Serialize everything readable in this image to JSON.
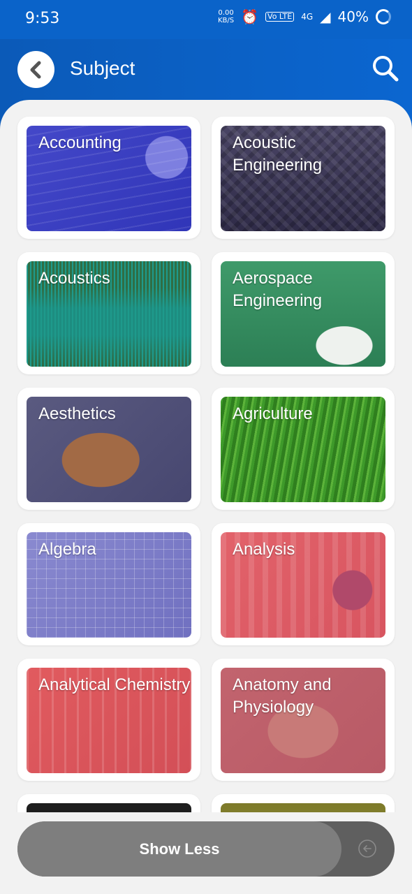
{
  "status_bar": {
    "time": "9:53",
    "net_speed_top": "0.00",
    "net_speed_bottom": "KB/S",
    "volte": "Vo LTE",
    "network": "4G",
    "battery": "40%"
  },
  "header": {
    "title": "Subject"
  },
  "subjects": [
    {
      "label": "Accounting"
    },
    {
      "label": "Acoustic Engineering"
    },
    {
      "label": "Acoustics"
    },
    {
      "label": "Aerospace Engineering"
    },
    {
      "label": "Aesthetics"
    },
    {
      "label": "Agriculture"
    },
    {
      "label": "Algebra"
    },
    {
      "label": "Analysis"
    },
    {
      "label": "Analytical Chemistry"
    },
    {
      "label": "Anatomy and Physiology"
    }
  ],
  "footer": {
    "show_less_label": "Show Less"
  },
  "colors": {
    "primary": "#0a63c9",
    "background": "#f2f2f2",
    "button": "#7e7e7e"
  }
}
